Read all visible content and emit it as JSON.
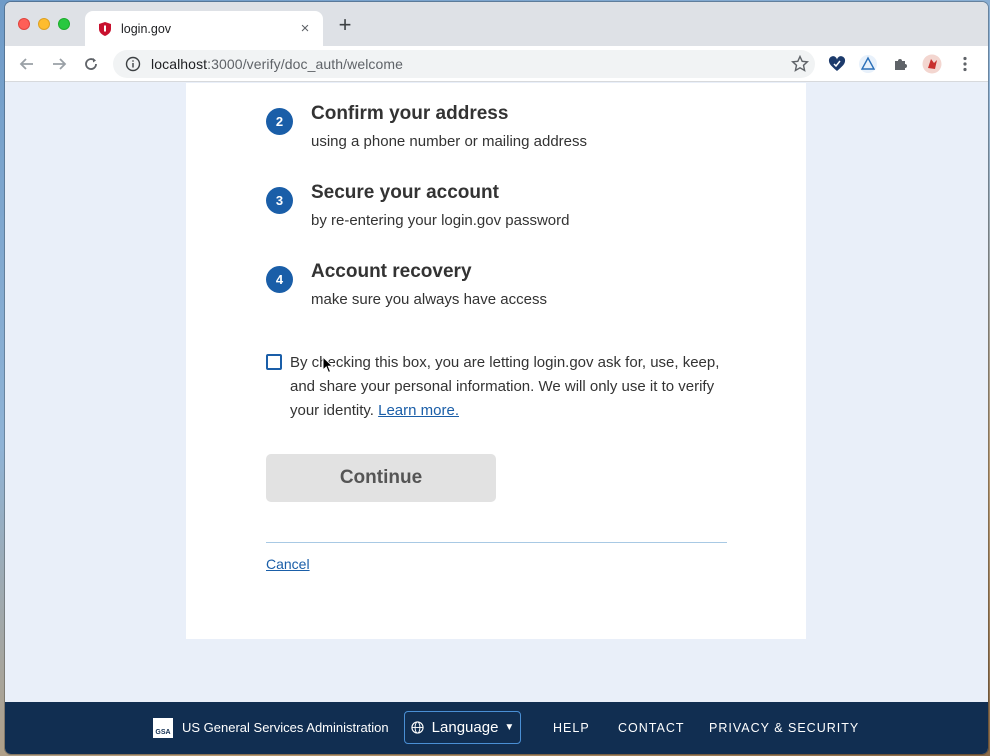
{
  "browser": {
    "tab_title": "login.gov",
    "tab_close": "×",
    "new_tab": "+",
    "url_host": "localhost",
    "url_rest": ":3000/verify/doc_auth/welcome"
  },
  "steps": [
    {
      "number": "2",
      "title": "Confirm your address",
      "description": "using a phone number or mailing address"
    },
    {
      "number": "3",
      "title": "Secure your account",
      "description": "by re-entering your login.gov password"
    },
    {
      "number": "4",
      "title": "Account recovery",
      "description": "make sure you always have access"
    }
  ],
  "consent": {
    "text": "By checking this box, you are letting login.gov ask for, use, keep, and share your personal information. We will only use it to verify your identity.",
    "learn_more": "Learn more.",
    "checked": false
  },
  "continue_label": "Continue",
  "cancel_label": "Cancel",
  "footer": {
    "logo_text": "GSA",
    "agency": "US General Services Administration",
    "language_label": "Language",
    "links": [
      "HELP",
      "CONTACT",
      "PRIVACY & SECURITY"
    ]
  },
  "colors": {
    "primary": "#1a5ea8",
    "footer_bg": "#112e51",
    "page_bg": "#e9eff9"
  }
}
